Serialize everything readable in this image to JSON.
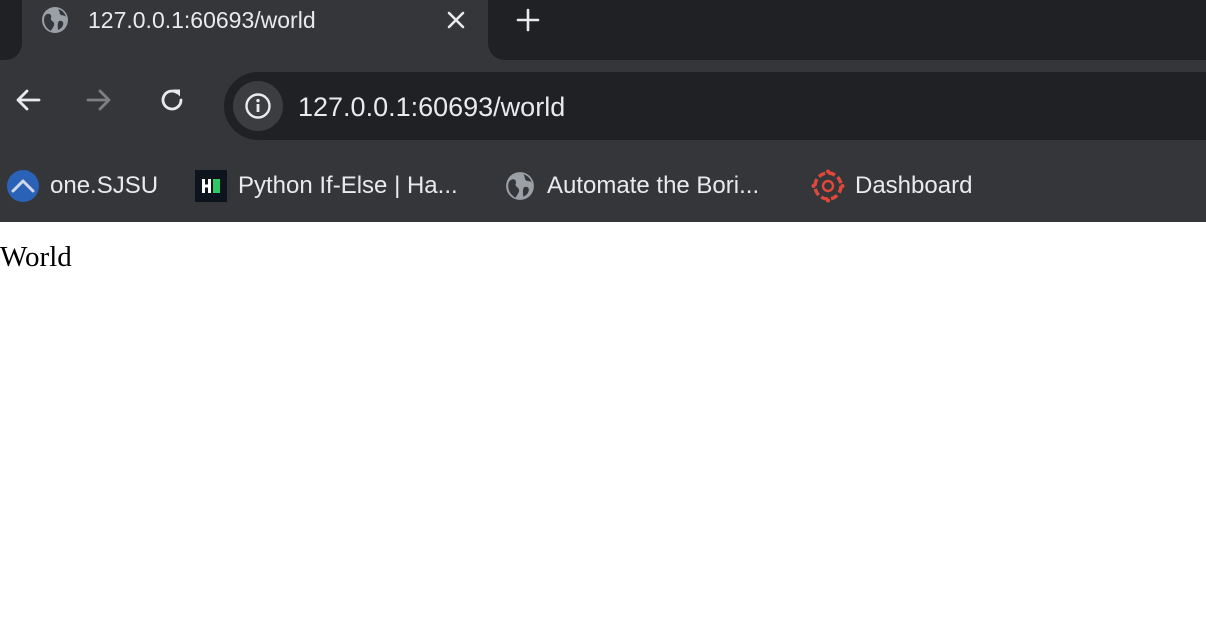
{
  "browser": {
    "tab": {
      "title": "127.0.0.1:60693/world",
      "favicon": "globe-icon"
    },
    "omnibox": {
      "url": "127.0.0.1:60693/world",
      "security_icon": "info-icon"
    },
    "nav": {
      "back_enabled": true,
      "forward_enabled": false
    },
    "bookmarks": [
      {
        "label": "one.SJSU",
        "icon": "sjsu-icon"
      },
      {
        "label": "Python If-Else | Ha...",
        "icon": "hackerrank-icon"
      },
      {
        "label": "Automate the Bori...",
        "icon": "globe-icon"
      },
      {
        "label": "Dashboard",
        "icon": "canvas-icon"
      }
    ]
  },
  "page": {
    "body_text": "World"
  },
  "colors": {
    "tabstrip_bg": "#202124",
    "toolbar_bg": "#35363a",
    "omnibox_bg": "#202124",
    "text_light": "#e8eaed",
    "sjsu_blue": "#2a62b8",
    "canvas_red": "#e0493a",
    "hackerrank_green": "#2ec866"
  }
}
